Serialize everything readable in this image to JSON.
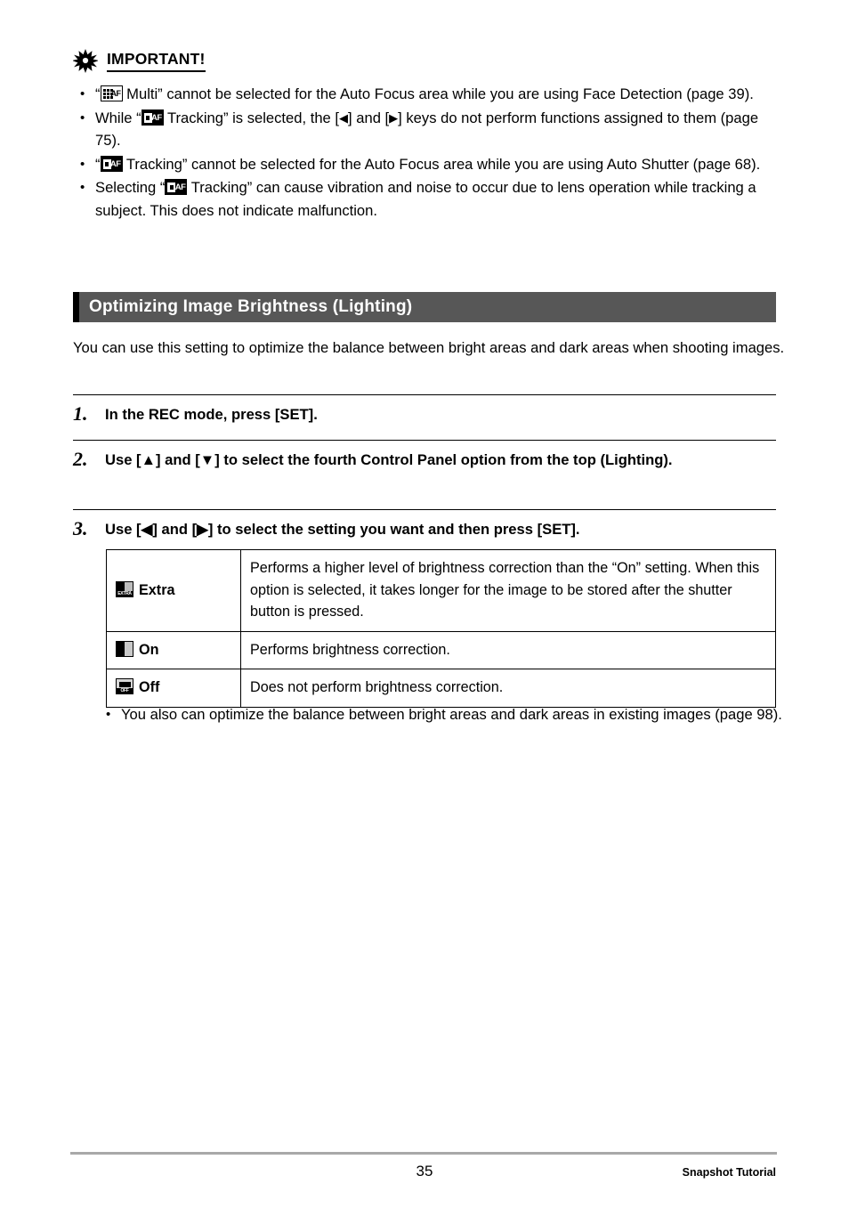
{
  "important": {
    "title": "IMPORTANT!",
    "icon": "burst-icon",
    "bullets": [
      {
        "parts": [
          {
            "type": "text",
            "value": "“"
          },
          {
            "type": "icon",
            "value": "af-multi-icon"
          },
          {
            "type": "text",
            "value": " Multi” cannot be selected for the Auto Focus area while you are using Face Detection (page 39)."
          }
        ],
        "plain": "“[AF Multi icon] Multi” cannot be selected for the Auto Focus area while you are using Face Detection (page 39)."
      },
      {
        "parts": [
          {
            "type": "text",
            "value": "While “"
          },
          {
            "type": "icon",
            "value": "af-tracking-icon"
          },
          {
            "type": "text",
            "value": " Tracking” is selected, the [◀] and [▶] keys do not perform functions assigned to them (page 75)."
          }
        ],
        "plain": "While “[AF Tracking icon] Tracking” is selected, the [◀] and [▶] keys do not perform functions assigned to them (page 75)."
      },
      {
        "parts": [
          {
            "type": "text",
            "value": "“"
          },
          {
            "type": "icon",
            "value": "af-tracking-icon"
          },
          {
            "type": "text",
            "value": " Tracking” cannot be selected for the Auto Focus area while you are using Auto Shutter (page 68)."
          }
        ],
        "plain": "“[AF Tracking icon] Tracking” cannot be selected for the Auto Focus area while you are using Auto Shutter (page 68)."
      },
      {
        "parts": [
          {
            "type": "text",
            "value": "Selecting “"
          },
          {
            "type": "icon",
            "value": "af-tracking-icon"
          },
          {
            "type": "text",
            "value": " Tracking” can cause vibration and noise to occur due to lens operation while tracking a subject. This does not indicate malfunction."
          }
        ],
        "plain": "Selecting “[AF Tracking icon] Tracking” can cause vibration and noise to occur due to lens operation while tracking a subject. This does not indicate malfunction."
      }
    ]
  },
  "section": {
    "heading": "Optimizing Image Brightness (Lighting)",
    "heading_bg": "#575757",
    "heading_color": "#ffffff",
    "intro": "You can use this setting to optimize the balance between bright areas and dark areas when shooting images."
  },
  "steps": [
    {
      "number": "1.",
      "text": "In the REC mode, press [SET]."
    },
    {
      "number": "2.",
      "text": "Use [▲] and [▼] to select the fourth Control Panel option from the top (Lighting)."
    },
    {
      "number": "3.",
      "text": "Use [◀] and [▶] to select the setting you want and then press [SET]."
    }
  ],
  "table": {
    "rows": [
      {
        "icon": "lighting-extra-icon",
        "label": "Extra",
        "description": "Performs a higher level of brightness correction than the “On” setting. When this option is selected, it takes longer for the image to be stored after the shutter button is pressed."
      },
      {
        "icon": "lighting-on-icon",
        "label": "On",
        "description": "Performs brightness correction."
      },
      {
        "icon": "lighting-off-icon",
        "label": "Off",
        "description": "Does not perform brightness correction."
      }
    ]
  },
  "tail_bullets": [
    "You also can optimize the balance between bright areas and dark areas in existing images (page 98)."
  ],
  "footer": {
    "page_number": "35",
    "section_label": "Snapshot Tutorial"
  }
}
